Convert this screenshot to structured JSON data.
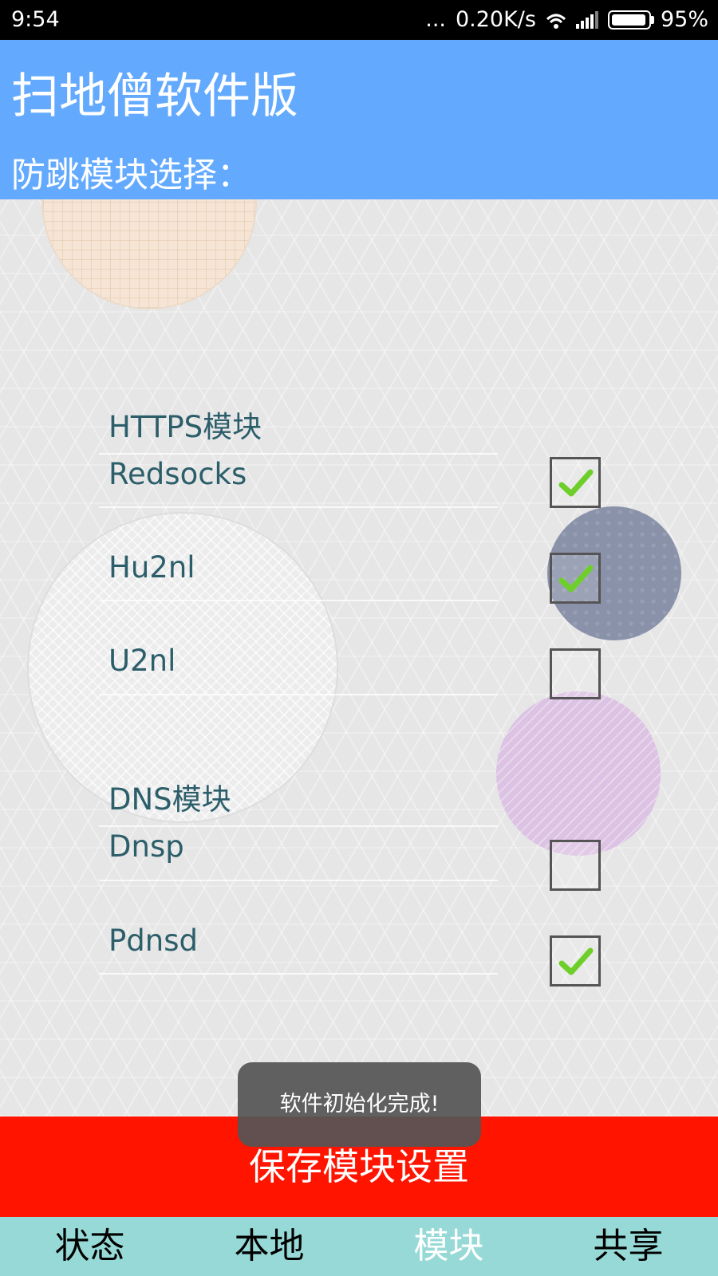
{
  "status_bar": {
    "time": "9:54",
    "dots": "...",
    "network_speed": "0.20K/s",
    "battery_percent": "95%",
    "battery_level": 0.95
  },
  "header": {
    "title": "扫地僧软件版",
    "subtitle": "防跳模块选择："
  },
  "modules": {
    "https_section": {
      "label": "HTTPS模块",
      "items": [
        {
          "label": "Redsocks",
          "checked": true
        },
        {
          "label": "Hu2nl",
          "checked": true
        },
        {
          "label": "U2nl",
          "checked": false
        }
      ]
    },
    "dns_section": {
      "label": "DNS模块",
      "items": [
        {
          "label": "Dnsp",
          "checked": false
        },
        {
          "label": "Pdnsd",
          "checked": true
        }
      ]
    }
  },
  "toast": {
    "message": "软件初始化完成!"
  },
  "save_button": {
    "label": "保存模块设置"
  },
  "tabs": [
    {
      "label": "状态",
      "active": false
    },
    {
      "label": "本地",
      "active": false
    },
    {
      "label": "模块",
      "active": true
    },
    {
      "label": "共享",
      "active": false
    }
  ],
  "colors": {
    "header_bg": "#63aaff",
    "save_bg": "#ff1400",
    "tabbar_bg": "#96d9d6",
    "check_green": "#6fcf2a"
  }
}
